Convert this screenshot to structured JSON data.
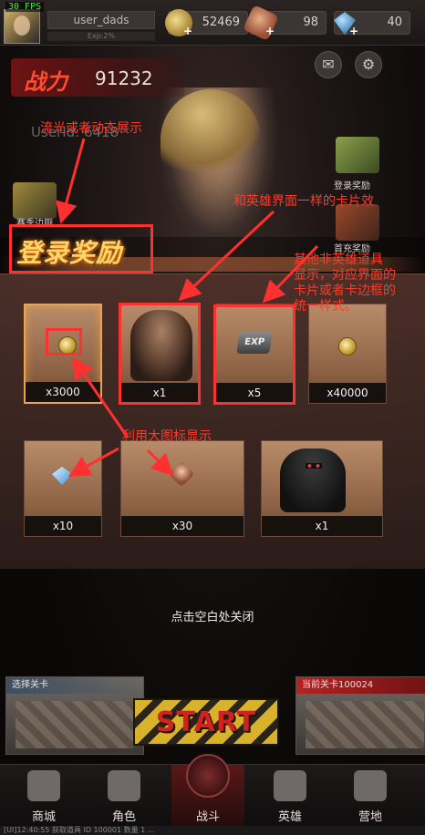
{
  "debug": {
    "fps": "30 FPS"
  },
  "player": {
    "name": "user_dads",
    "exp": "Exp:2%"
  },
  "resources": [
    {
      "icon": "gold-coin-icon",
      "value": "52469"
    },
    {
      "icon": "medal-icon",
      "value": "98"
    },
    {
      "icon": "diamond-icon",
      "value": "40"
    }
  ],
  "power": {
    "label": "战力",
    "value": "91232"
  },
  "background": {
    "ghost_name": "UserId: 6418"
  },
  "side_buttons": {
    "left_label": "赛季边厕",
    "right_top_label": "登录奖励",
    "right_bottom_label": "首充奖励"
  },
  "banner": {
    "title": "登录奖励"
  },
  "rewards": [
    {
      "icon": "gold-coin-icon",
      "qty": "x3000"
    },
    {
      "icon": "soldier-hero-card",
      "qty": "x1"
    },
    {
      "icon": "exp-card-icon",
      "qty": "x5"
    },
    {
      "icon": "gold-coin-icon",
      "qty": "x40000"
    },
    {
      "icon": "diamond-icon",
      "qty": "x10"
    },
    {
      "icon": "medal-icon",
      "qty": "x30"
    },
    {
      "icon": "masked-soldier-card",
      "qty": "x1"
    }
  ],
  "annotations": {
    "flash": "流光或者动态展示",
    "same_card": "和英雄界面一样的卡片效",
    "other_items": [
      "其他非英雄道具",
      "显示，对应界面的",
      "卡片或者卡边框的",
      "统一样式。"
    ],
    "big_icon": "利用大图标显示",
    "exp_badge": "EXP"
  },
  "close_hint": "点击空白处关闭",
  "stages": {
    "left_title": "选择关卡",
    "right_title": "当前关卡100024"
  },
  "start_label": "START",
  "nav": [
    {
      "icon": "shop-icon",
      "label": "商城"
    },
    {
      "icon": "character-icon",
      "label": "角色"
    },
    {
      "icon": "skull-battle-icon",
      "label": "战斗"
    },
    {
      "icon": "heroes-icon",
      "label": "英雄"
    },
    {
      "icon": "camp-icon",
      "label": "营地"
    }
  ],
  "ticker": "[UI]12:40:55 获取道具 ID 100001 数量 1 ..."
}
